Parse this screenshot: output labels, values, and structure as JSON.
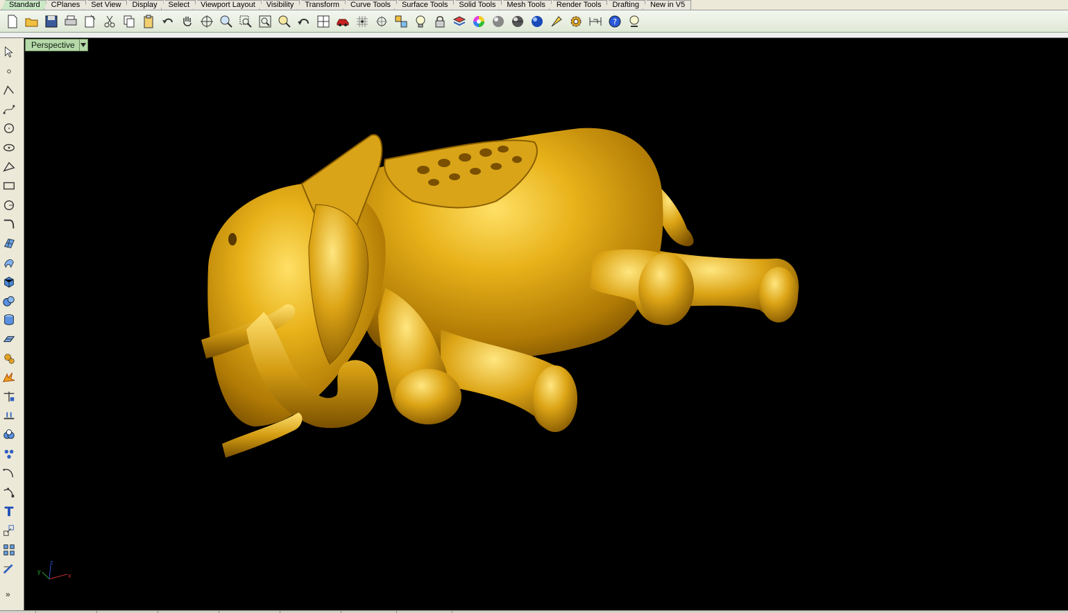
{
  "tabs": [
    {
      "label": "Standard",
      "active": true
    },
    {
      "label": "CPlanes"
    },
    {
      "label": "Set View"
    },
    {
      "label": "Display"
    },
    {
      "label": "Select"
    },
    {
      "label": "Viewport Layout"
    },
    {
      "label": "Visibility"
    },
    {
      "label": "Transform"
    },
    {
      "label": "Curve Tools"
    },
    {
      "label": "Surface Tools"
    },
    {
      "label": "Solid Tools"
    },
    {
      "label": "Mesh Tools"
    },
    {
      "label": "Render Tools"
    },
    {
      "label": "Drafting"
    },
    {
      "label": "New in V5"
    }
  ],
  "toolbar_icons": [
    "new-file-icon",
    "open-folder-icon",
    "save-icon",
    "print-icon",
    "import-icon",
    "cut-icon",
    "copy-icon",
    "paste-icon",
    "undo-icon",
    "pan-hand-icon",
    "rotate-view-icon",
    "zoom-icon",
    "zoom-window-icon",
    "zoom-extents-icon",
    "zoom-selected-icon",
    "undo-view-icon",
    "four-viewports-icon",
    "car-icon",
    "grid-snap-icon",
    "object-snap-icon",
    "select-objects-icon",
    "light-bulb-icon",
    "lock-icon",
    "layer-icon",
    "color-wheel-icon",
    "shaded-sphere-icon",
    "rendered-sphere-icon",
    "render-blue-sphere-icon",
    "pointer-star-icon",
    "options-gear-icon",
    "dimension-icon",
    "help-icon",
    "customize-icon"
  ],
  "left_tools": [
    "select-arrow-icon",
    "point-icon",
    "polyline-icon",
    "curve-points-icon",
    "circle-icon",
    "ellipse-icon",
    "polygon-icon",
    "rectangle-icon",
    "arc-icon",
    "fillet-curve-icon",
    "surface-grid-icon",
    "surface-sweep-icon",
    "box-solid-icon",
    "sphere-solid-icon",
    "cylinder-solid-icon",
    "plane-surface-icon",
    "mesh-gear-icon",
    "explode-icon",
    "trim-icon",
    "split-icon",
    "boolean-union-icon",
    "group-icon",
    "curve-edit-icon",
    "control-points-icon",
    "text-icon",
    "scale-icon",
    "array-icon",
    "dimension-edit-icon"
  ],
  "expand_label": "»",
  "viewport": {
    "title": "Perspective",
    "background": "#000000",
    "model_color": "#e0a010",
    "axes": {
      "x": "x",
      "y": "y",
      "z": "z"
    }
  },
  "colors": {
    "active_tab": "#c9e8c6",
    "viewport_tab": "#b5d9a9",
    "axis_x": "#c03030",
    "axis_y": "#30a030",
    "axis_z": "#3050d0"
  }
}
